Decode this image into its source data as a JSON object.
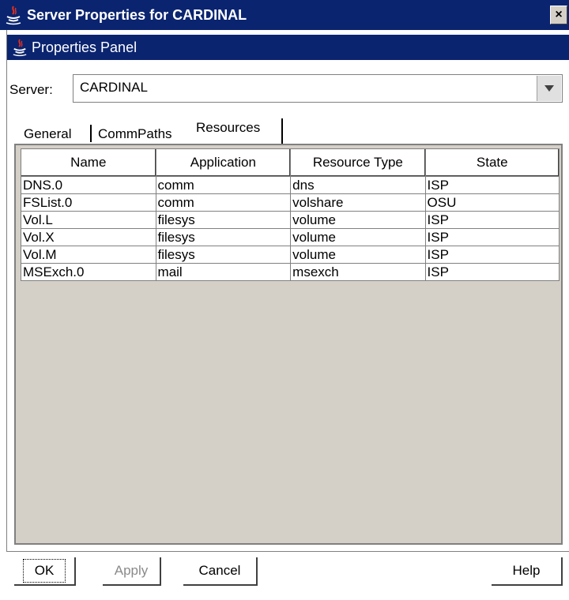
{
  "window": {
    "title": "Server Properties for CARDINAL",
    "close_label": "×"
  },
  "panel": {
    "title": "Properties Panel"
  },
  "server": {
    "label": "Server:",
    "value": "CARDINAL"
  },
  "tabs": [
    {
      "label": "General"
    },
    {
      "label": "CommPaths"
    },
    {
      "label": "Resources",
      "active": true
    }
  ],
  "table": {
    "columns": [
      "Name",
      "Application",
      "Resource Type",
      "State"
    ],
    "rows": [
      [
        "DNS.0",
        "comm",
        "dns",
        "ISP"
      ],
      [
        "FSList.0",
        "comm",
        "volshare",
        "OSU"
      ],
      [
        "Vol.L",
        "filesys",
        "volume",
        "ISP"
      ],
      [
        "Vol.X",
        "filesys",
        "volume",
        "ISP"
      ],
      [
        "Vol.M",
        "filesys",
        "volume",
        "ISP"
      ],
      [
        "MSExch.0",
        "mail",
        "msexch",
        "ISP"
      ]
    ]
  },
  "buttons": {
    "ok": "OK",
    "apply": "Apply",
    "cancel": "Cancel",
    "help": "Help"
  },
  "colors": {
    "titlebar": "#0a2470",
    "background": "#d4d0c8"
  },
  "icons": {
    "app": "java-icon",
    "dropdown": "chevron-down-icon",
    "close": "close-icon"
  }
}
